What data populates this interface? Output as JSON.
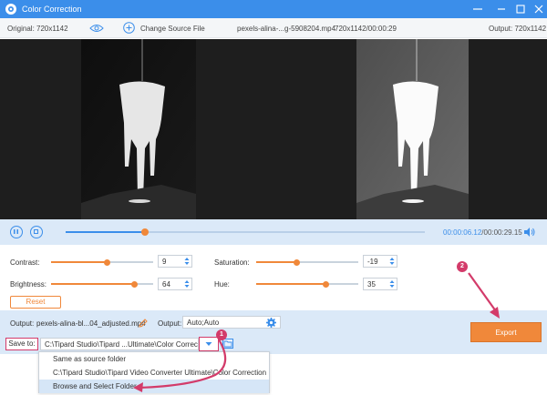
{
  "app": {
    "title": "Color Correction"
  },
  "infobar": {
    "original": "Original: 720x1142",
    "change_source": "Change Source File",
    "filename": "pexels-alina-...g-5908204.mp4",
    "resolution_time": "720x1142/00:00:29",
    "output": "Output: 720x1142"
  },
  "playback": {
    "progress": 0.22,
    "current_time": "00:00:06.12",
    "total_time": "/00:00:29.15"
  },
  "adjust": {
    "contrast": {
      "label": "Contrast:",
      "value": "9",
      "level": 0.55
    },
    "brightness": {
      "label": "Brightness:",
      "value": "64",
      "level": 0.82
    },
    "saturation": {
      "label": "Saturation:",
      "value": "-19",
      "level": 0.4
    },
    "hue": {
      "label": "Hue:",
      "value": "35",
      "level": 0.68
    },
    "reset_label": "Reset"
  },
  "output": {
    "output_label": "Output:",
    "output_file": "pexels-alina-bl...04_adjusted.mp4",
    "format_label": "Output:",
    "format_value": "Auto;Auto",
    "save_to_label": "Save to:",
    "save_path": "C:\\Tipard Studio\\Tipard ...Ultimate\\Color Correction",
    "export_label": "Export"
  },
  "dropdown": {
    "items": [
      "Same as source folder",
      "C:\\Tipard Studio\\Tipard Video Converter Ultimate\\Color Correction",
      "Browse and Select Folder"
    ]
  },
  "badges": {
    "one": "1",
    "two": "2"
  },
  "colors": {
    "accent": "#3b8eea",
    "orange": "#f0883a",
    "annotation": "#d33b6a"
  }
}
